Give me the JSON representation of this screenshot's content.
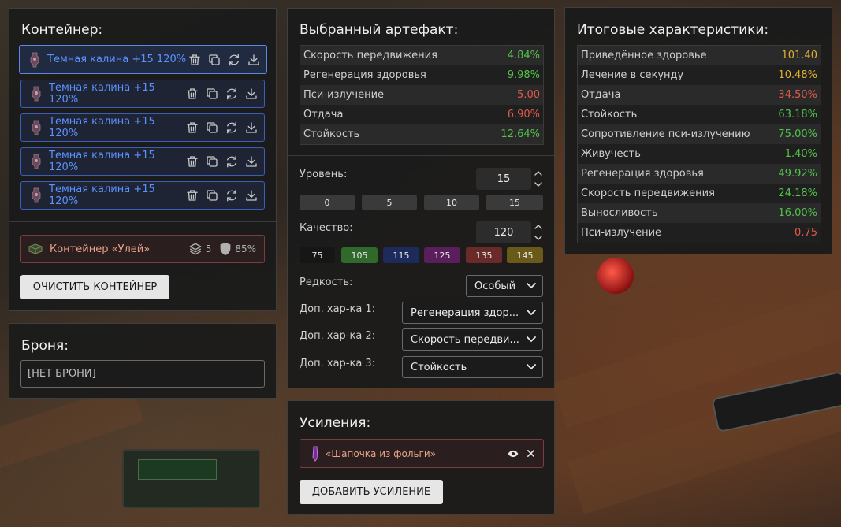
{
  "container_panel": {
    "title": "Контейнер:",
    "items": [
      {
        "name": "Темная калина +15 120%"
      },
      {
        "name": "Темная калина +15 120%"
      },
      {
        "name": "Темная калина +15 120%"
      },
      {
        "name": "Темная калина +15 120%"
      },
      {
        "name": "Темная калина +15 120%"
      }
    ],
    "hive": {
      "name": "Контейнер «Улей»",
      "slots": "5",
      "protection": "85%"
    },
    "clear_button": "ОЧИСТИТЬ КОНТЕЙНЕР"
  },
  "armor_panel": {
    "title": "Броня:",
    "value": "[НЕТ БРОНИ]"
  },
  "artifact_panel": {
    "title": "Выбранный артефакт:",
    "stats": [
      {
        "label": "Скорость передвижения",
        "value": "4.84%",
        "color": "green"
      },
      {
        "label": "Регенерация здоровья",
        "value": "9.98%",
        "color": "green"
      },
      {
        "label": "Пси-излучение",
        "value": "5.00",
        "color": "red"
      },
      {
        "label": "Отдача",
        "value": "6.90%",
        "color": "red"
      },
      {
        "label": "Стойкость",
        "value": "12.64%",
        "color": "green"
      }
    ],
    "level_label": "Уровень:",
    "level_value": "15",
    "level_presets": [
      "0",
      "5",
      "10",
      "15"
    ],
    "quality_label": "Качество:",
    "quality_value": "120",
    "quality_presets": [
      {
        "label": "75",
        "color": "#161616"
      },
      {
        "label": "105",
        "color": "#2f6a2c"
      },
      {
        "label": "115",
        "color": "#1e2a5c"
      },
      {
        "label": "125",
        "color": "#5a1e5c"
      },
      {
        "label": "135",
        "color": "#6a2a2a"
      },
      {
        "label": "145",
        "color": "#6a5a1a"
      }
    ],
    "rarity_label": "Редкость:",
    "rarity_value": "Особый",
    "extra1_label": "Доп. хар-ка 1:",
    "extra1_value": "Регенерация здор...",
    "extra2_label": "Доп. хар-ка 2:",
    "extra2_value": "Скорость передви...",
    "extra3_label": "Доп. хар-ка 3:",
    "extra3_value": "Стойкость"
  },
  "boost_panel": {
    "title": "Усиления:",
    "item": "«Шапочка из фольги»",
    "add_button": "ДОБАВИТЬ УСИЛЕНИЕ"
  },
  "totals_panel": {
    "title": "Итоговые характеристики:",
    "stats": [
      {
        "label": "Приведённое здоровье",
        "value": "101.40",
        "color": "yellow"
      },
      {
        "label": "Лечение в секунду",
        "value": "10.48%",
        "color": "yellow"
      },
      {
        "label": "Отдача",
        "value": "34.50%",
        "color": "red"
      },
      {
        "label": "Стойкость",
        "value": "63.18%",
        "color": "green"
      },
      {
        "label": "Сопротивление пси-излучению",
        "value": "75.00%",
        "color": "green"
      },
      {
        "label": "Живучесть",
        "value": "1.40%",
        "color": "green"
      },
      {
        "label": "Регенерация здоровья",
        "value": "49.92%",
        "color": "green"
      },
      {
        "label": "Скорость передвижения",
        "value": "24.18%",
        "color": "green"
      },
      {
        "label": "Выносливость",
        "value": "16.00%",
        "color": "green"
      },
      {
        "label": "Пси-излучение",
        "value": "0.75",
        "color": "red"
      }
    ]
  }
}
